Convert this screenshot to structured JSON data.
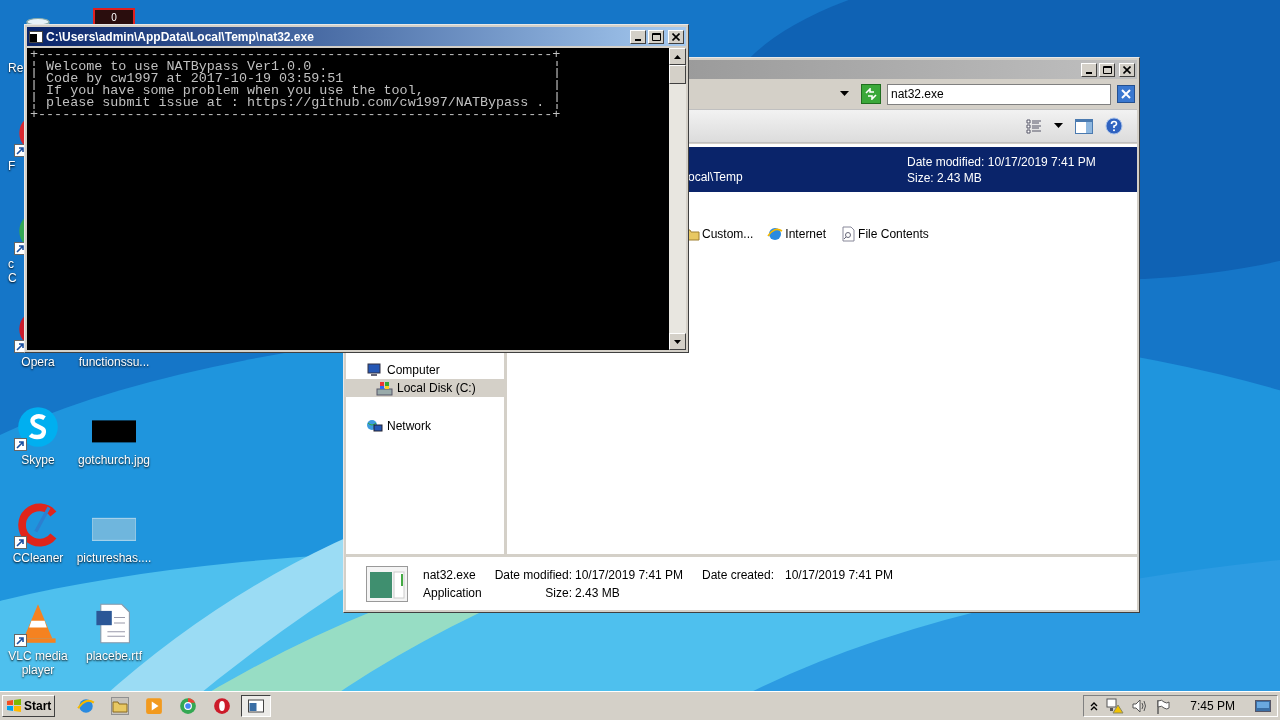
{
  "desktop": {
    "column_1": [
      {
        "label": "Re",
        "kind": "recycle-bin"
      },
      {
        "label": "F",
        "kind": "red-ball",
        "shortcut": true
      },
      {
        "label": "c\nC",
        "kind": "chrome",
        "shortcut": true
      },
      {
        "label": "Opera",
        "kind": "opera",
        "shortcut": true
      },
      {
        "label": "Skype",
        "kind": "skype",
        "shortcut": true
      },
      {
        "label": "CCleaner",
        "kind": "ccleaner",
        "shortcut": true
      },
      {
        "label": "VLC media\nplayer",
        "kind": "vlc",
        "shortcut": true
      }
    ],
    "column_2": [
      {
        "kind": "counter",
        "icon_text": "0"
      },
      {
        "label": "functionssu...",
        "kind": "hidden-thumb"
      },
      {
        "label": "gotchurch.jpg",
        "kind": "dark-thumb"
      },
      {
        "label": "pictureshas....",
        "kind": "light-thumb"
      },
      {
        "label": "placebe.rtf",
        "kind": "word-doc"
      }
    ]
  },
  "explorer": {
    "search": {
      "value": "nat32.exe"
    },
    "result": {
      "path": "ocal\\Temp",
      "date_modified": "Date modified: 10/17/2019 7:41 PM",
      "size": "Size: 2.43 MB",
      "selected": true
    },
    "search_again": [
      {
        "label": "Custom...",
        "kind": "custom"
      },
      {
        "label": "Internet",
        "kind": "internet"
      },
      {
        "label": "File Contents",
        "kind": "contents"
      }
    ],
    "nav": [
      {
        "label": "Computer",
        "kind": "computer",
        "selected": false,
        "children": [
          {
            "label": "Local Disk (C:)",
            "kind": "disk",
            "selected": true
          }
        ]
      },
      {
        "label": "Network",
        "kind": "network",
        "selected": false
      }
    ],
    "details": {
      "name": "nat32.exe",
      "type": "Application",
      "fields": [
        {
          "label": "Date modified:",
          "value": "10/17/2019 7:41 PM"
        },
        {
          "label": "Size:",
          "value": "2.43 MB"
        },
        {
          "label": "Date created:",
          "value": "10/17/2019 7:41 PM"
        }
      ]
    }
  },
  "console": {
    "title": "C:\\Users\\admin\\AppData\\Local\\Temp\\nat32.exe",
    "border_top": "+----------------------------------------------------------------+",
    "edge": "¦",
    "lines": [
      "Welcome to use NATBypass Ver1.0.0 .",
      "Code by cw1997 at 2017-10-19 03:59:51",
      "If you have some problem when you use the tool,",
      "please submit issue at : https://github.com/cw1997/NATBypass ."
    ],
    "border_bottom": "+----------------------------------------------------------------+"
  },
  "taskbar": {
    "start": "Start",
    "quick_launch": [
      {
        "kind": "ie"
      },
      {
        "kind": "folder"
      },
      {
        "kind": "media"
      },
      {
        "kind": "chrome"
      },
      {
        "kind": "opera"
      }
    ],
    "tasks": [
      {
        "kind": "console",
        "selected": true
      }
    ],
    "tray": {
      "clock": "7:45 PM"
    }
  }
}
